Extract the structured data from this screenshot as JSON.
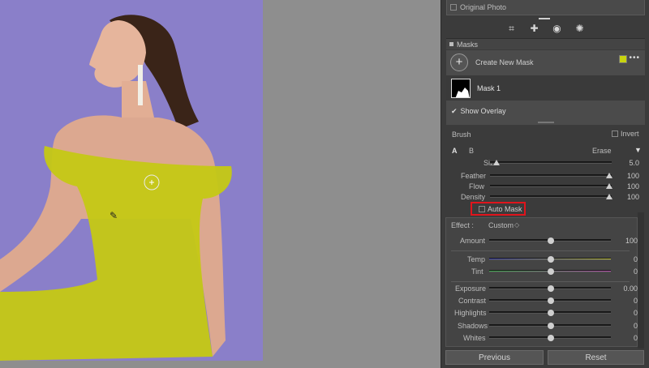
{
  "panel": {
    "original_photo_label": "Original Photo",
    "masks_title": "Masks",
    "create_new_mask": "Create New Mask",
    "mask_name": "Mask 1",
    "show_overlay_label": "Show Overlay",
    "overlay_color": "#c8d40e",
    "brush": {
      "title": "Brush",
      "invert_label": "Invert",
      "tab_a": "A",
      "tab_b": "B",
      "erase_label": "Erase",
      "size_label": "Size",
      "size_value": "5.0",
      "feather_label": "Feather",
      "feather_value": "100",
      "flow_label": "Flow",
      "flow_value": "100",
      "density_label": "Density",
      "density_value": "100",
      "auto_mask_label": "Auto Mask"
    },
    "effect": {
      "effect_label": "Effect :",
      "preset": "Custom",
      "amount_label": "Amount",
      "amount_value": "100",
      "temp_label": "Temp",
      "temp_value": "0",
      "tint_label": "Tint",
      "tint_value": "0",
      "exposure_label": "Exposure",
      "exposure_value": "0.00",
      "contrast_label": "Contrast",
      "contrast_value": "0",
      "highlights_label": "Highlights",
      "highlights_value": "0",
      "shadows_label": "Shadows",
      "shadows_value": "0",
      "whites_label": "Whites",
      "whites_value": "0"
    },
    "previous_button": "Previous",
    "reset_button": "Reset"
  }
}
